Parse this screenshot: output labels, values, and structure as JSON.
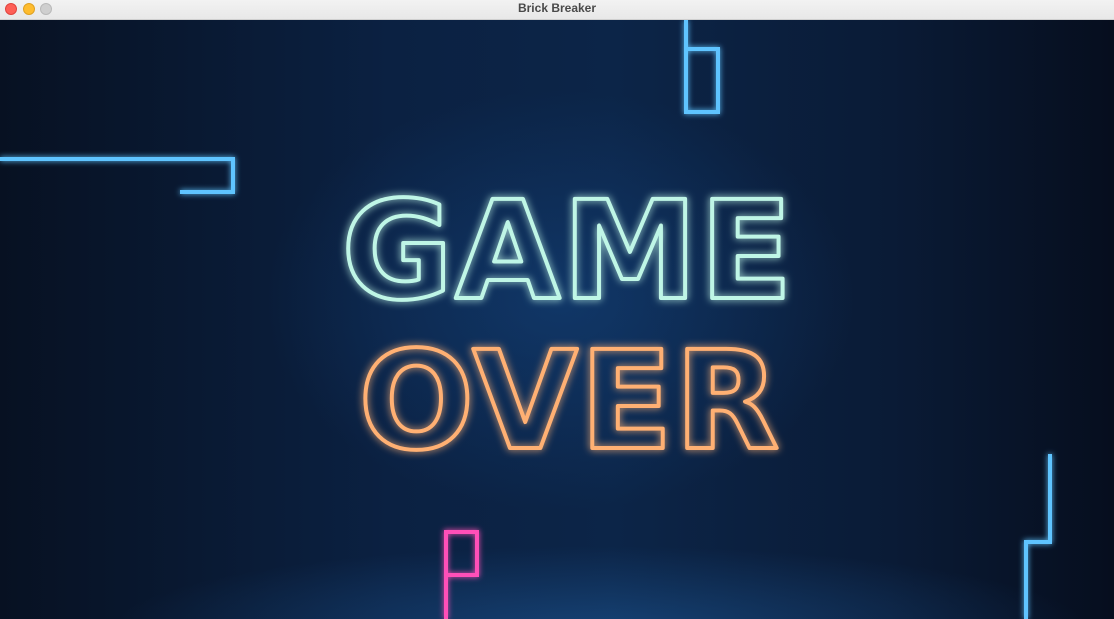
{
  "window": {
    "title": "Brick Breaker"
  },
  "game": {
    "line1": "GAME",
    "line2": "OVER"
  },
  "colors": {
    "game_text": "#bff6e6",
    "over_text": "#ffb073",
    "blue_brick": "#5fc4ff",
    "pink_brick": "#ff4fb8"
  }
}
